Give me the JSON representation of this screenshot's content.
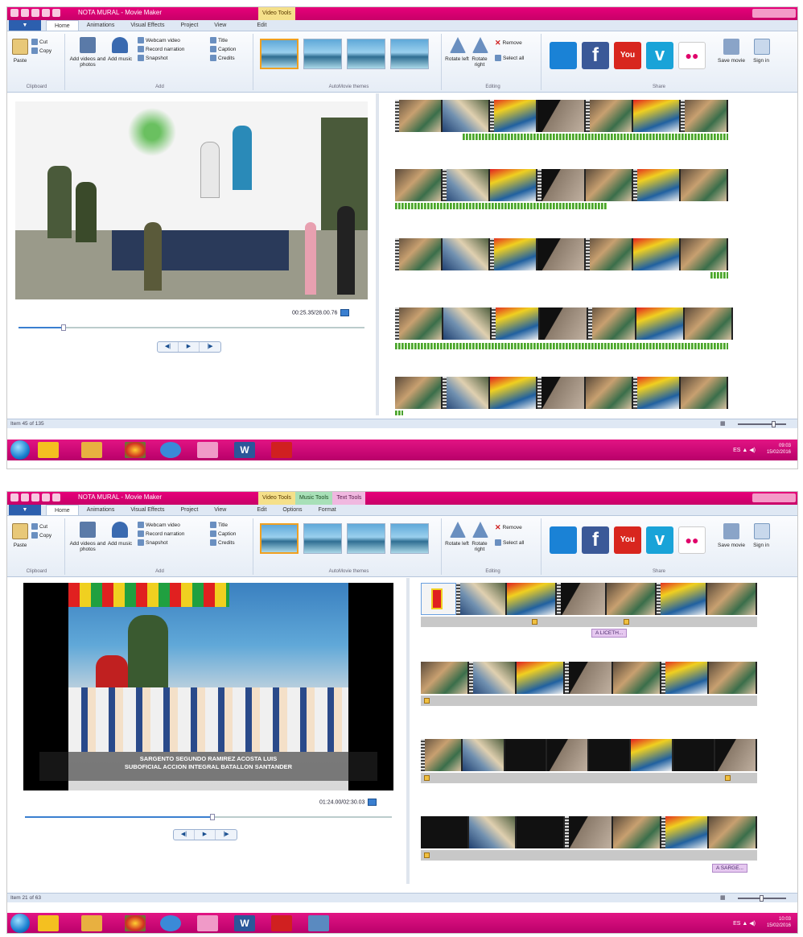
{
  "screens": [
    {
      "window_title": "NOTA MURAL - Movie Maker",
      "context_tabs": [
        "Video Tools"
      ],
      "tabs": [
        "Home",
        "Animations",
        "Visual Effects",
        "Project",
        "View",
        "Edit"
      ],
      "file_button": "",
      "timecode": "00:25.35/28.00.76",
      "status": "Item 45 of 135",
      "seek_fraction": 0.13,
      "zoom_fraction": 0.7
    },
    {
      "window_title": "NOTA MURAL - Movie Maker",
      "context_tabs": [
        "Video Tools",
        "Music Tools",
        "Text Tools"
      ],
      "tabs": [
        "Home",
        "Animations",
        "Visual Effects",
        "Project",
        "View",
        "Edit",
        "Options",
        "Format"
      ],
      "file_button": "",
      "timecode": "01:24.00/02:30.03",
      "status": "Item 21 of 63",
      "seek_fraction": 0.51,
      "zoom_fraction": 0.45,
      "overlay_line1": "SARGENTO SEGUNDO RAMIREZ ACOSTA LUIS",
      "overlay_line2": "SUBOFICIAL ACCION INTEGRAL BATALLON SANTANDER",
      "caption_tags": [
        "A LICETH...",
        "A SARGE..."
      ]
    }
  ],
  "ribbon": {
    "clipboard": {
      "paste": "Paste",
      "cut": "Cut",
      "copy": "Copy",
      "group": "Clipboard"
    },
    "add": {
      "add_videos": "Add videos and photos",
      "add_music": "Add music",
      "webcam": "Webcam video",
      "narration": "Record narration",
      "snapshot": "Snapshot",
      "title": "Title",
      "caption": "Caption",
      "credits": "Credits",
      "group": "Add"
    },
    "themes_group": "AutoMovie themes",
    "editing": {
      "rotate_left": "Rotate left",
      "rotate_right": "Rotate right",
      "remove": "Remove",
      "select_all": "Select all",
      "group": "Editing"
    },
    "share": {
      "group": "Share",
      "save_movie": "Save movie",
      "sign_in": "Sign in",
      "items": [
        {
          "icon": "onedrive-icon",
          "color": "#1a82d6"
        },
        {
          "icon": "facebook-icon",
          "color": "#3b5998",
          "glyph": "f"
        },
        {
          "icon": "youtube-icon",
          "color": "#d8261e",
          "glyph": "You"
        },
        {
          "icon": "vimeo-icon",
          "color": "#19a3d8",
          "glyph": "v"
        },
        {
          "icon": "flickr-icon",
          "color": "#ffffff",
          "glyph": "●●"
        }
      ]
    }
  },
  "playback": {
    "prev": "◀|",
    "play": "▶",
    "next": "|▶"
  },
  "taskbar": {
    "time1": "09:03",
    "date1": "15/02/2016",
    "time2": "10:03",
    "date2": "15/02/2016",
    "tray": "ES ▲ ◀)"
  },
  "colors": {
    "accent_pink": "#e6007a",
    "ribbon_blue": "#2c5fae",
    "selection": "#f0a020"
  }
}
